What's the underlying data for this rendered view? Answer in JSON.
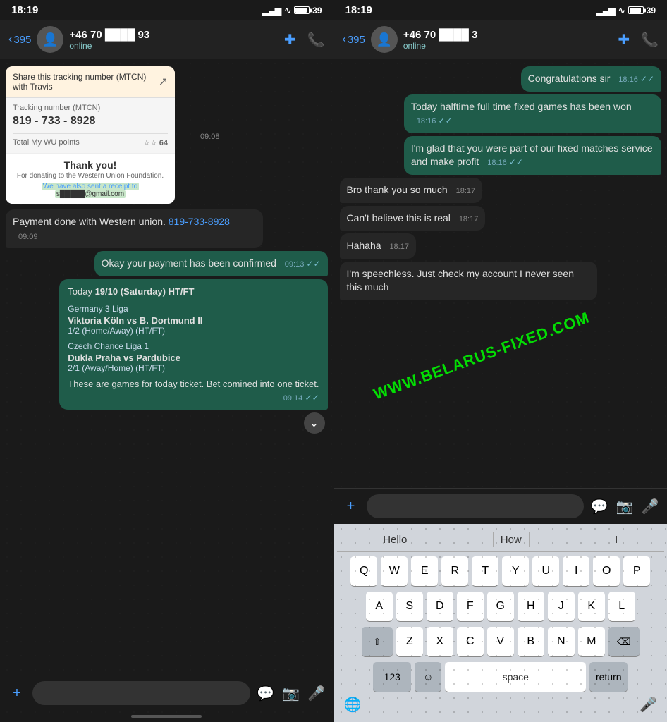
{
  "left_panel": {
    "status_bar": {
      "time": "18:19",
      "battery": "39"
    },
    "header": {
      "back_label": "395",
      "contact_name": "+46 70 ████ 93",
      "contact_status": "online",
      "call_icon": "📞"
    },
    "messages": [
      {
        "type": "incoming",
        "content_type": "wu_card",
        "wu": {
          "header": "Share this tracking number (MTCN) with Travis",
          "tracking_label": "Tracking number (MTCN)",
          "tracking_number": "819 - 733 - 8928",
          "points_label": "Total My WU points",
          "points_value": "64",
          "thankyou_title": "Thank you!",
          "thankyou_sub": "For donating to the Western Union Foundation.",
          "email_prefix": "We have also sent a receipt to",
          "email": "s█████@gmail.com"
        },
        "time": "09:08"
      },
      {
        "type": "incoming",
        "text": "Payment done with Western union. 819-733-8928",
        "link": "819-733-8928",
        "time": "09:09"
      },
      {
        "type": "outgoing",
        "text": "Okay your payment has been confirmed",
        "time": "09:13"
      },
      {
        "type": "outgoing",
        "content_type": "matches",
        "date_line": "Today 19/10 (Saturday) HT/FT",
        "matches": [
          {
            "league": "Germany 3 Liga",
            "teams": "Viktoria Köln vs B. Dortmund II",
            "result": "1/2 (Home/Away) (HT/FT)"
          },
          {
            "league": "Czech Chance Liga 1",
            "teams": "Dukla Praha vs Pardubice",
            "result": "2/1 (Away/Home) (HT/FT)"
          }
        ],
        "footer": "These are games for today ticket. Bet comined into one ticket.",
        "time": "09:14"
      }
    ],
    "input_bar": {
      "plus_icon": "+",
      "emoji_icon": "🙂",
      "mic_icon": "🎤"
    }
  },
  "right_panel": {
    "status_bar": {
      "time": "18:19",
      "battery": "39"
    },
    "header": {
      "back_label": "395",
      "contact_name": "+46 70 ████ 3",
      "contact_status": "online",
      "call_icon": "📞"
    },
    "messages": [
      {
        "type": "outgoing",
        "text": "Congratulations sir",
        "time": "18:16"
      },
      {
        "type": "outgoing",
        "text": "Today halftime full time fixed games has been won",
        "time": "18:16"
      },
      {
        "type": "outgoing",
        "text": "I'm glad that you were part of our fixed matches service and make profit",
        "time": "18:16"
      },
      {
        "type": "incoming",
        "text": "Bro thank you so much",
        "time": "18:17"
      },
      {
        "type": "incoming",
        "text": "Can't believe this is real",
        "time": "18:17"
      },
      {
        "type": "incoming",
        "text": "Hahaha",
        "time": "18:17"
      },
      {
        "type": "incoming",
        "text": "I'm speechless. Just check my account I never seen this much",
        "time": ""
      }
    ],
    "input_bar": {
      "plus_icon": "+",
      "sticker_icon": "💬",
      "camera_icon": "📷",
      "mic_icon": "🎤"
    },
    "keyboard": {
      "suggestions": [
        "Hello",
        "How",
        "I"
      ],
      "rows": [
        [
          "Q",
          "W",
          "E",
          "R",
          "T",
          "Y",
          "U",
          "I",
          "O",
          "P"
        ],
        [
          "A",
          "S",
          "D",
          "F",
          "G",
          "H",
          "J",
          "K",
          "L"
        ],
        [
          "Z",
          "X",
          "C",
          "V",
          "B",
          "N",
          "M"
        ]
      ],
      "special_left": "⇧",
      "special_right": "⌫",
      "bottom": {
        "num_label": "123",
        "emoji_label": "☺",
        "space_label": "space",
        "return_label": "return"
      },
      "globe": "🌐",
      "mic": "🎤"
    }
  },
  "watermark": "WWW.BELARUS-FIXED.COM"
}
